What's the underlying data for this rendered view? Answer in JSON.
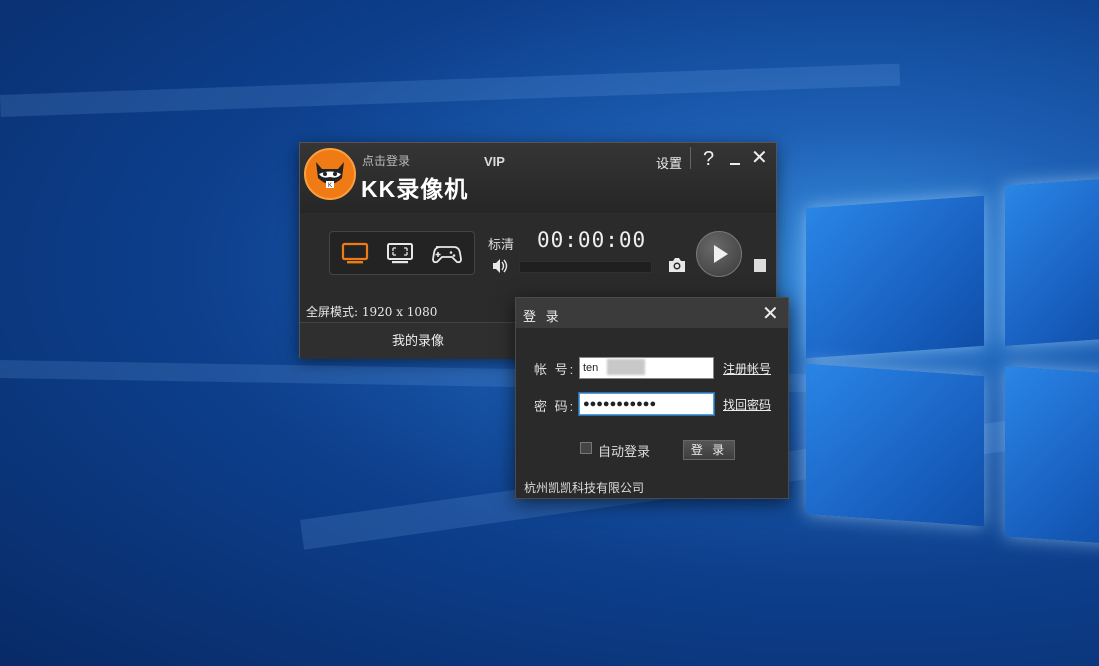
{
  "main_window": {
    "login_hint": "点击登录",
    "app_title": "KK录像机",
    "vip_label": "VIP",
    "settings_label": "设置",
    "help_label": "?",
    "close_label": "✕",
    "quality_label": "标清",
    "timer": "00:00:00",
    "mode_text": "全屏模式: 1920 x 1080",
    "recordings_button": "我的录像",
    "recording_modes": [
      {
        "name": "fullscreen-mode-icon",
        "selected": true
      },
      {
        "name": "region-mode-icon",
        "selected": false
      },
      {
        "name": "game-mode-icon",
        "selected": false
      }
    ],
    "accent_color": "#f07a14"
  },
  "login_dialog": {
    "title": "登 录",
    "close_label": "✕",
    "account_label": "帐 号:",
    "account_value": "ten",
    "password_label": "密 码:",
    "password_value": "●●●●●●●●●●●",
    "register_link": "注册帐号",
    "recover_link": "找回密码",
    "auto_login_label": "自动登录",
    "auto_login_checked": false,
    "login_button": "登 录",
    "company": "杭州凯凯科技有限公司"
  }
}
